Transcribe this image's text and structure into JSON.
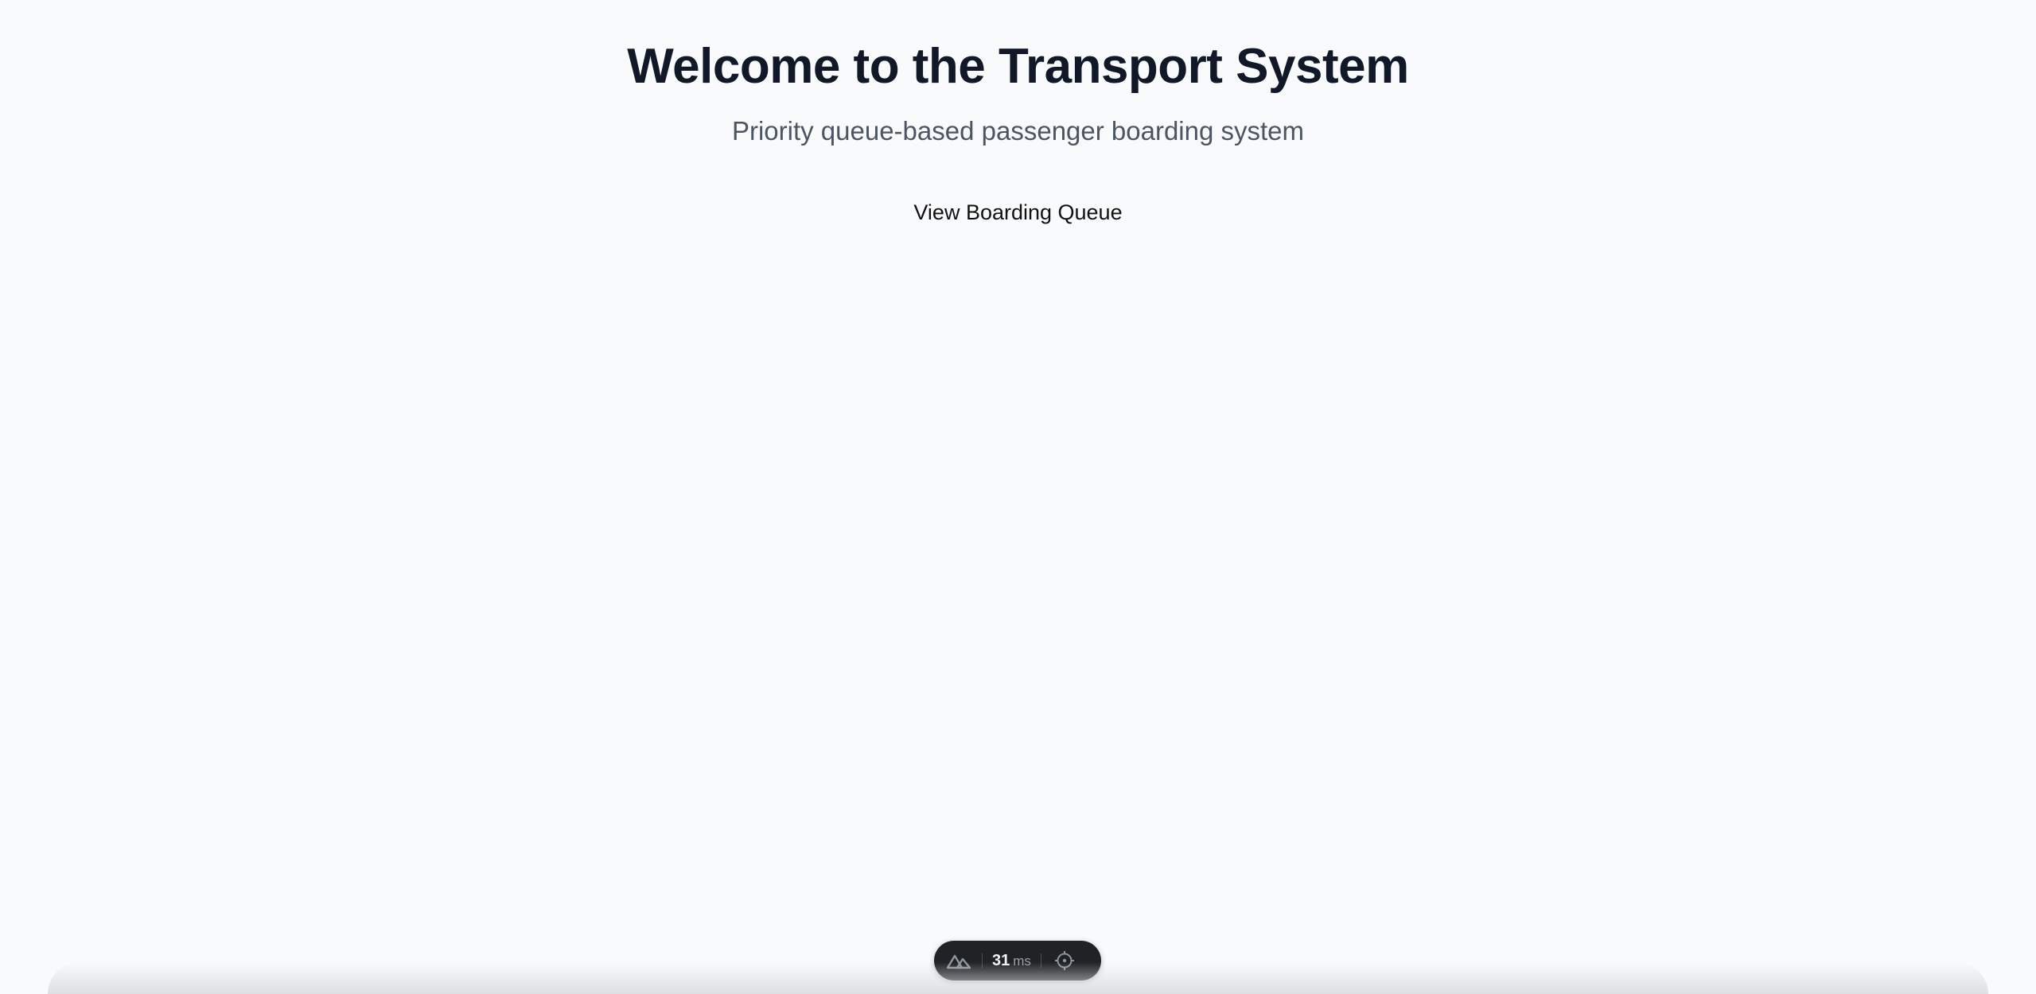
{
  "hero": {
    "title": "Welcome to the Transport System",
    "subtitle": "Priority queue-based passenger boarding system",
    "queue_link_label": "View Boarding Queue"
  },
  "devtools": {
    "logo_icon": "nuxt-logo-icon",
    "timing_value": "31",
    "timing_unit": "ms",
    "inspect_icon": "crosshair-target-icon"
  },
  "colors": {
    "background": "#f8fafc",
    "title": "#111827",
    "subtitle": "#4b5563",
    "pill": "#202326"
  }
}
